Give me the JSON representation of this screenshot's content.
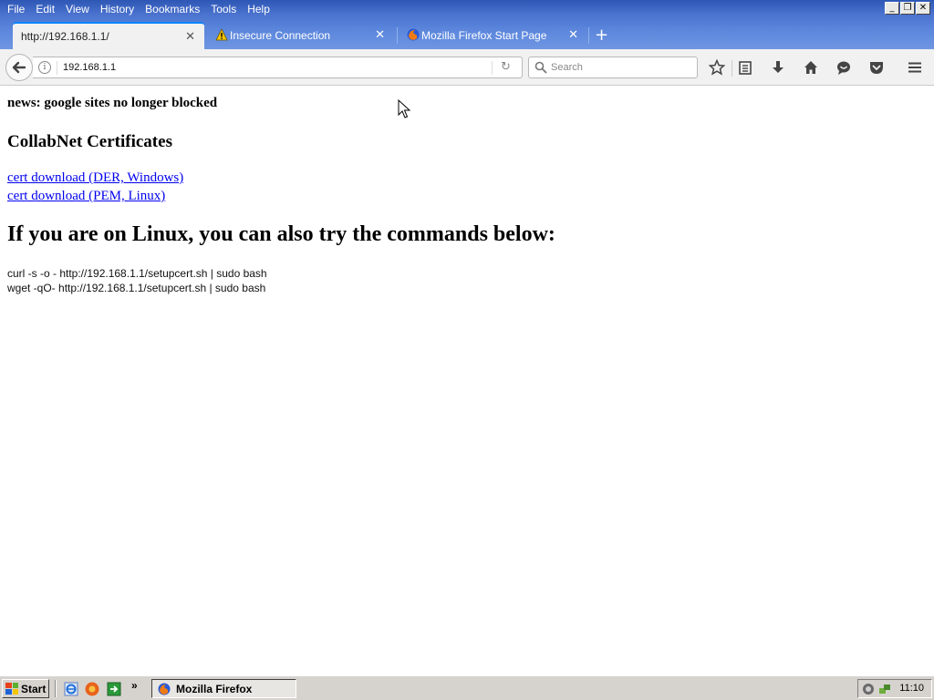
{
  "menu": [
    "File",
    "Edit",
    "View",
    "History",
    "Bookmarks",
    "Tools",
    "Help"
  ],
  "window_controls": [
    "minimize",
    "restore",
    "close"
  ],
  "tabs": [
    {
      "title": "http://192.168.1.1/",
      "active": true
    },
    {
      "title": "Insecure Connection",
      "active": false,
      "icon": "warning-icon"
    },
    {
      "title": "Mozilla Firefox Start Page",
      "active": false,
      "icon": "firefox-icon"
    }
  ],
  "navbar": {
    "url": "192.168.1.1",
    "search_placeholder": "Search"
  },
  "page": {
    "news": "news: google sites no longer blocked",
    "certs_heading": "CollabNet Certificates",
    "link_der": "cert download (DER, Windows)",
    "link_pem": "cert download (PEM, Linux)",
    "linux_heading": "If you are on Linux, you can also try the commands below:",
    "cmd_curl": "curl -s -o - http://192.168.1.1/setupcert.sh | sudo bash",
    "cmd_wget": "wget -qO- http://192.168.1.1/setupcert.sh | sudo bash"
  },
  "taskbar": {
    "start_label": "Start",
    "task_label": "Mozilla Firefox",
    "clock": "11:10",
    "more": "»"
  },
  "colors": {
    "titlebar": "#4b73cf",
    "link": "#0000ee",
    "tab_accent": "#0a84ff"
  }
}
